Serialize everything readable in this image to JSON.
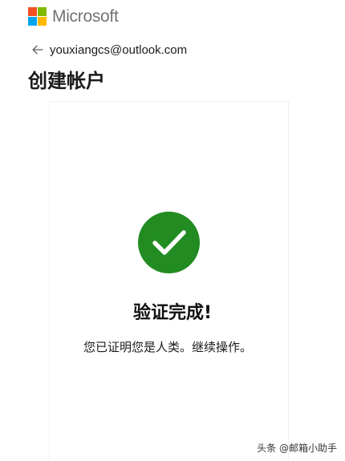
{
  "header": {
    "brand_name": "Microsoft",
    "logo_colors": [
      "#f25022",
      "#7fba00",
      "#00a4ef",
      "#ffb900"
    ]
  },
  "identity": {
    "back_icon": "arrow-left-icon",
    "email": "youxiangcs@outlook.com"
  },
  "title": "创建帐户",
  "verification": {
    "icon": "checkmark-icon",
    "icon_color": "#228b22",
    "heading": "验证完成!",
    "message": "您已证明您是人类。继续操作。"
  },
  "watermark": {
    "text": "头条 @邮箱小助手"
  }
}
